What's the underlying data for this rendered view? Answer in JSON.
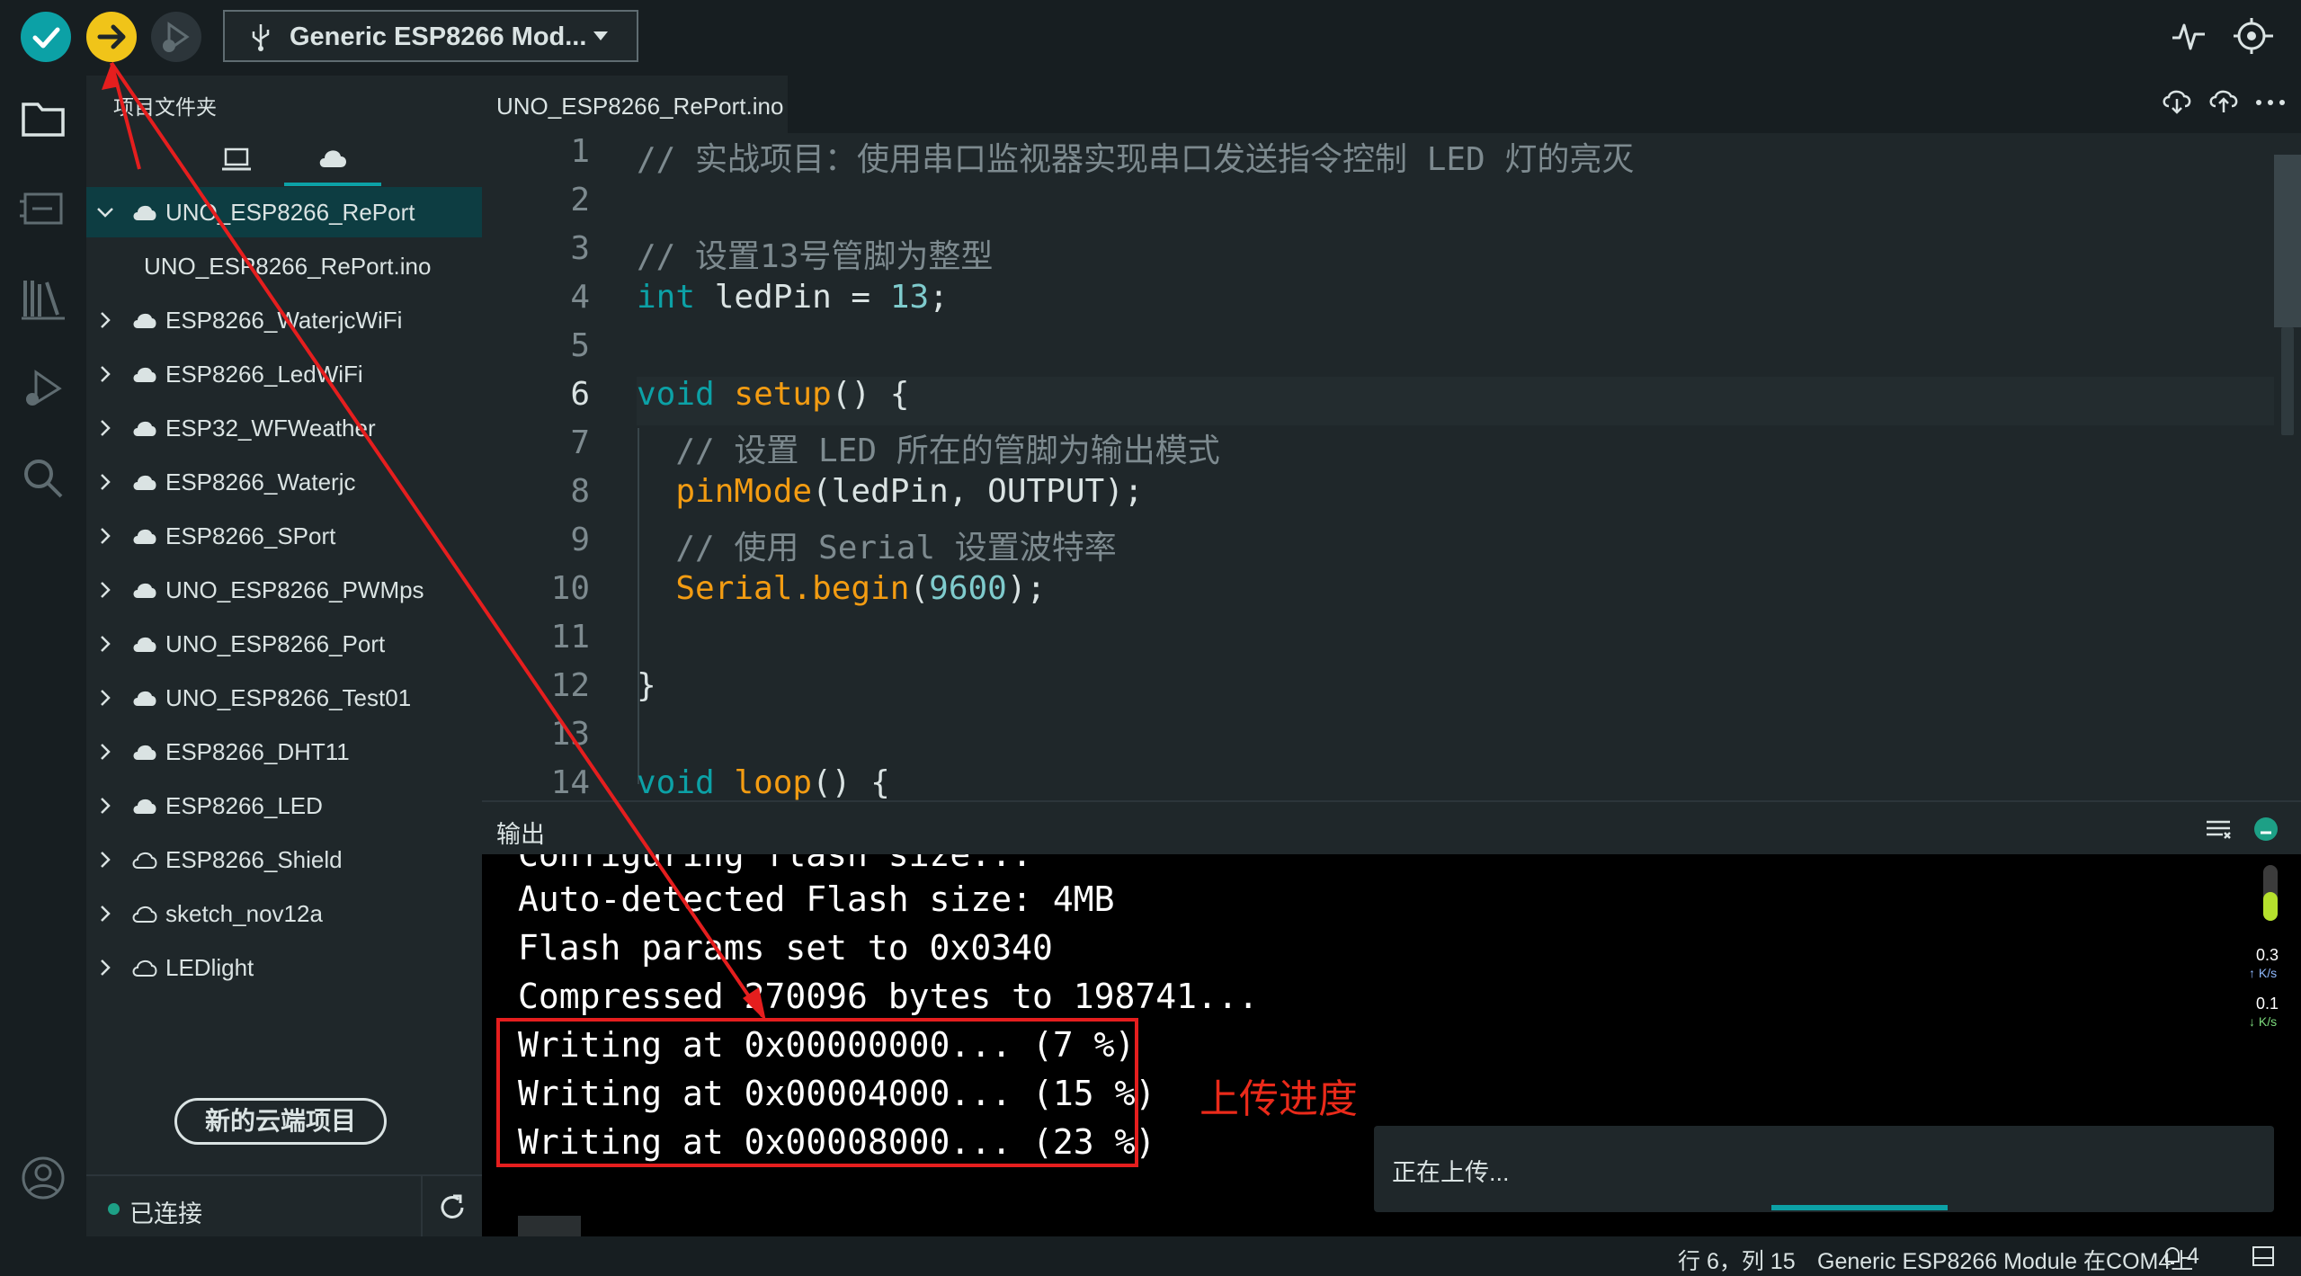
{
  "toolbar": {
    "verify_icon": "check-icon",
    "upload_icon": "arrow-right-icon",
    "debug_icon": "debug-icon",
    "board": "Generic ESP8266 Mod...",
    "right_icons": [
      "serial-plotter-icon",
      "serial-monitor-icon"
    ]
  },
  "activity": [
    "folder-icon",
    "board-icon",
    "library-icon",
    "debug-icon",
    "search-icon",
    "account-icon"
  ],
  "sidebar": {
    "title": "项目文件夹",
    "tabs": [
      "local-icon",
      "cloud-icon"
    ],
    "items": [
      {
        "label": "UNO_ESP8266_RePort",
        "type": "cloud-filled",
        "expanded": true
      },
      {
        "label": "UNO_ESP8266_RePort.ino",
        "type": "file"
      },
      {
        "label": "ESP8266_WaterjcWiFi",
        "type": "cloud-filled"
      },
      {
        "label": "ESP8266_LedWiFi",
        "type": "cloud-filled"
      },
      {
        "label": "ESP32_WFWeather",
        "type": "cloud-filled"
      },
      {
        "label": "ESP8266_Waterjc",
        "type": "cloud-filled"
      },
      {
        "label": "ESP8266_SPort",
        "type": "cloud-filled"
      },
      {
        "label": "UNO_ESP8266_PWMps",
        "type": "cloud-filled"
      },
      {
        "label": "UNO_ESP8266_Port",
        "type": "cloud-filled"
      },
      {
        "label": "UNO_ESP8266_Test01",
        "type": "cloud-filled"
      },
      {
        "label": "ESP8266_DHT11",
        "type": "cloud-filled"
      },
      {
        "label": "ESP8266_LED",
        "type": "cloud-filled"
      },
      {
        "label": "ESP8266_Shield",
        "type": "cloud-outline"
      },
      {
        "label": "sketch_nov12a",
        "type": "cloud-outline"
      },
      {
        "label": "LEDlight",
        "type": "cloud-outline"
      }
    ],
    "new_cloud_button": "新的云端项目",
    "connection": "已连接"
  },
  "editor": {
    "tab": "UNO_ESP8266_RePort.ino",
    "header_icons": [
      "cloud-download-icon",
      "cloud-upload-icon",
      "more-icon"
    ],
    "line_numbers": [
      "1",
      "2",
      "3",
      "4",
      "5",
      "6",
      "7",
      "8",
      "9",
      "10",
      "11",
      "12",
      "13",
      "14"
    ],
    "lines": {
      "l1": "// 实战项目：使用串口监视器实现串口发送指令控制 LED 灯的亮灭",
      "l3": "// 设置13号管脚为整型",
      "l4_kw": "int",
      "l4_rest": " ledPin = ",
      "l4_num": "13",
      "l4_end": ";",
      "l6_kw": "void",
      "l6_fn": "setup",
      "l6_end": "() {",
      "l7": "  // 设置 LED 所在的管脚为输出模式",
      "l8_fn": "pinMode",
      "l8_rest": "(ledPin, OUTPUT);",
      "l9": "  // 使用 Serial 设置波特率",
      "l10_fn": "Serial.begin",
      "l10_a": "(",
      "l10_num": "9600",
      "l10_end": ");",
      "l12": "}",
      "l14_kw": "void",
      "l14_fn": "loop",
      "l14_end": "() {"
    }
  },
  "output": {
    "title": "输出",
    "lines": [
      "Configuring flash size...",
      "Auto-detected Flash size: 4MB",
      "Flash params set to 0x0340",
      "Compressed 270096 bytes to 198741...",
      "Writing at 0x00000000... (7 %)",
      "Writing at 0x00004000... (15 %)",
      "Writing at 0x00008000... (23 %)"
    ],
    "annotation": "上传进度",
    "net_up": "0.3",
    "net_down": "0.1",
    "net_unit": "K/s"
  },
  "notification": {
    "text": "正在上传...",
    "progress": 0.2
  },
  "status": {
    "position": "行 6，列 15",
    "board": "Generic ESP8266 Module 在COM4上",
    "notifications": "4"
  },
  "colors": {
    "accent": "#0ca1a6",
    "upload": "#f0c419",
    "annotation_red": "#e51e1e",
    "background": "#171e21"
  }
}
